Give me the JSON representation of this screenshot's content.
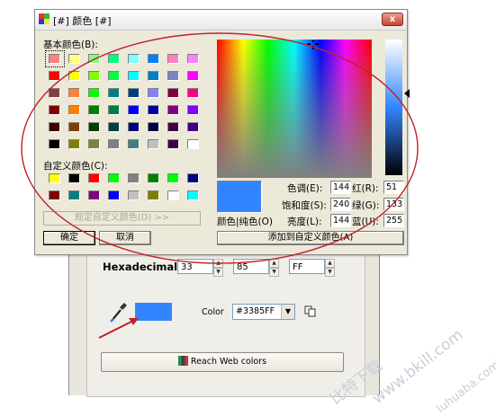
{
  "dialog": {
    "title": "[#] 颜色 [#]",
    "close_label": "x",
    "basic_colors_label": "基本颜色(B):",
    "custom_colors_label": "自定义颜色(C):",
    "define_custom_button": "规定自定义颜色(D) >>",
    "ok_button": "确定",
    "cancel_button": "取消",
    "color_solid_label": "颜色|纯色(O)",
    "add_custom_button": "添加到自定义颜色(A)",
    "hue_label": "色调(E):",
    "hue_value": "144",
    "sat_label": "饱和度(S):",
    "sat_value": "240",
    "lum_label": "亮度(L):",
    "lum_value": "144",
    "red_label": "红(R):",
    "red_value": "51",
    "green_label": "绿(G):",
    "green_value": "133",
    "blue_label": "蓝(U):",
    "blue_value": "255",
    "preview_color": "#3385FF",
    "basic_colors": [
      [
        "#FF8080",
        "#FFFF80",
        "#80FF80",
        "#00FF80",
        "#80FFFF",
        "#0080FF",
        "#FF80C0",
        "#FF80FF"
      ],
      [
        "#FF0000",
        "#FFFF00",
        "#80FF00",
        "#00FF40",
        "#00FFFF",
        "#0080C0",
        "#8080C0",
        "#FF00FF"
      ],
      [
        "#804040",
        "#FF8040",
        "#00FF00",
        "#008080",
        "#004080",
        "#8080FF",
        "#800040",
        "#FF0080"
      ],
      [
        "#800000",
        "#FF8000",
        "#008000",
        "#008040",
        "#0000FF",
        "#0000A0",
        "#800080",
        "#8000FF"
      ],
      [
        "#400000",
        "#804000",
        "#004000",
        "#004040",
        "#000080",
        "#000040",
        "#400040",
        "#400080"
      ],
      [
        "#000000",
        "#808000",
        "#808040",
        "#808080",
        "#408080",
        "#C0C0C0",
        "#400040",
        "#FFFFFF"
      ]
    ],
    "custom_colors": [
      [
        "#FFFF00",
        "#000000",
        "#FF0000",
        "#00FF00",
        "#808080",
        "#008000",
        "#00FF00",
        "#000080"
      ],
      [
        "#800000",
        "#008080",
        "#800080",
        "#0000FF",
        "#C0C0C0",
        "#808000",
        "#FFFFFF",
        "#00FFFF"
      ]
    ]
  },
  "app": {
    "hex_label": "Hexadecimal",
    "hex_r": "33",
    "hex_g": "85",
    "hex_b": "FF",
    "color_label": "Color",
    "color_value": "#3385FF",
    "reach_button": "Reach Web colors",
    "swatch_color": "#3385FF"
  },
  "watermark": {
    "line1": "比特下载",
    "line2": "www.bkill.com",
    "line3": "luhuaba.com下载"
  },
  "colors": {
    "annotation_red": "#C0202A",
    "accent": "#3385FF"
  }
}
